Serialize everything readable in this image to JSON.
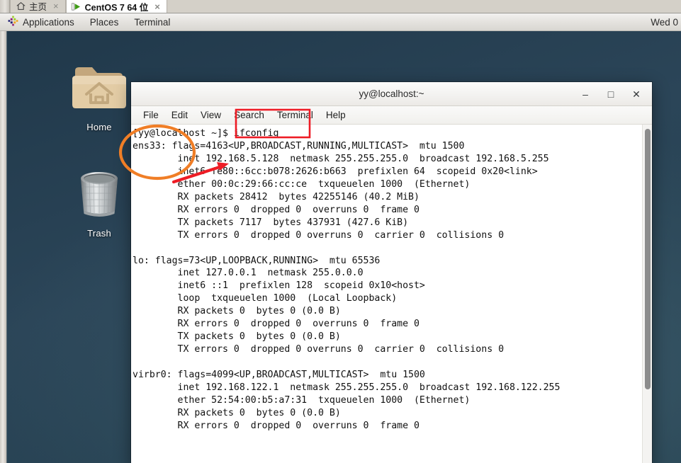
{
  "vmware": {
    "tabs": [
      {
        "label": "主页",
        "icon": "home-icon",
        "active": false,
        "close": "×"
      },
      {
        "label": "CentOS 7 64 位",
        "icon": "play-icon",
        "active": true,
        "close": "×"
      }
    ]
  },
  "panel": {
    "applications_label": "Applications",
    "places_label": "Places",
    "terminal_label": "Terminal",
    "clock": "Wed 0",
    "logo_icon": "centos-logo-icon"
  },
  "desktop": {
    "background_color": "#2b4558",
    "icons": [
      {
        "label": "Home",
        "icon": "home-folder-icon"
      },
      {
        "label": "Trash",
        "icon": "trash-bin-icon"
      }
    ]
  },
  "terminal": {
    "title": "yy@localhost:~",
    "window_controls": {
      "minimize": "–",
      "maximize": "□",
      "close": "✕"
    },
    "menu": [
      "File",
      "Edit",
      "View",
      "Search",
      "Terminal",
      "Help"
    ],
    "prompt": "[yy@localhost ~]$ ",
    "command": "ifconfig",
    "output": "[yy@localhost ~]$ ifconfig\nens33: flags=4163<UP,BROADCAST,RUNNING,MULTICAST>  mtu 1500\n        inet 192.168.5.128  netmask 255.255.255.0  broadcast 192.168.5.255\n        inet6 fe80::6cc:b078:2626:b663  prefixlen 64  scopeid 0x20<link>\n        ether 00:0c:29:66:cc:ce  txqueuelen 1000  (Ethernet)\n        RX packets 28412  bytes 42255146 (40.2 MiB)\n        RX errors 0  dropped 0  overruns 0  frame 0\n        TX packets 7117  bytes 437931 (427.6 KiB)\n        TX errors 0  dropped 0 overruns 0  carrier 0  collisions 0\n\nlo: flags=73<UP,LOOPBACK,RUNNING>  mtu 65536\n        inet 127.0.0.1  netmask 255.0.0.0\n        inet6 ::1  prefixlen 128  scopeid 0x10<host>\n        loop  txqueuelen 1000  (Local Loopback)\n        RX packets 0  bytes 0 (0.0 B)\n        RX errors 0  dropped 0  overruns 0  frame 0\n        TX packets 0  bytes 0 (0.0 B)\n        TX errors 0  dropped 0 overruns 0  carrier 0  collisions 0\n\nvirbr0: flags=4099<UP,BROADCAST,MULTICAST>  mtu 1500\n        inet 192.168.122.1  netmask 255.255.255.0  broadcast 192.168.122.255\n        ether 52:54:00:b5:a7:31  txqueuelen 1000  (Ethernet)\n        RX packets 0  bytes 0 (0.0 B)\n        RX errors 0  dropped 0  overruns 0  frame 0"
  },
  "annotations": {
    "ellipse": {
      "color": "#f07e26",
      "target": "ens33-interface"
    },
    "rectangle": {
      "color": "#ee1c25",
      "target": "ifconfig-command"
    },
    "arrow": {
      "color": "#ee1c25",
      "target": "inet-address"
    }
  }
}
